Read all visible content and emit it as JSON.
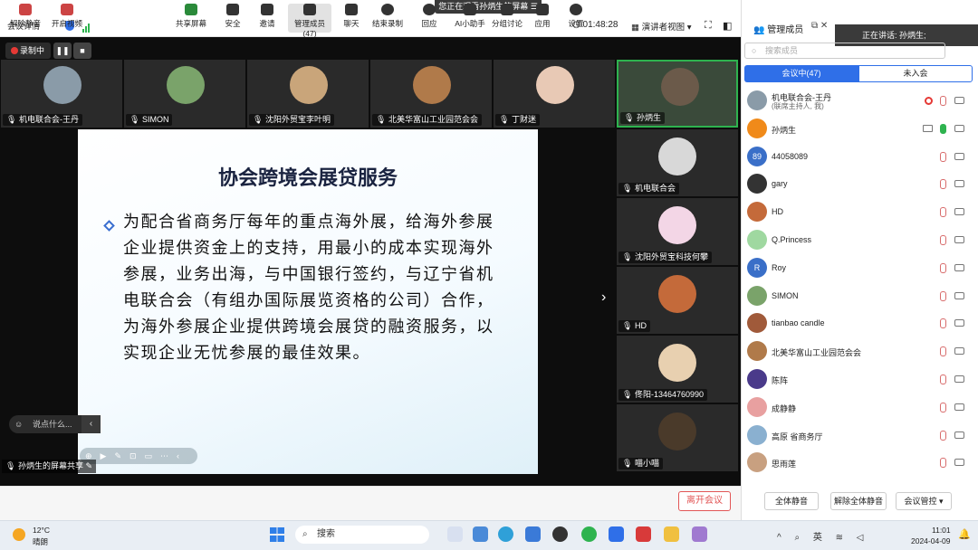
{
  "topbar": {
    "meeting_detail": "会议详情",
    "watching": "您正在观看孙炳生的屏幕",
    "watching_icon": "menu-lines-icon",
    "timer": "01:48:28",
    "view_mode": "演讲者视图"
  },
  "recording": {
    "label": "录制中",
    "pause": "❚❚",
    "stop": "■"
  },
  "tiles": [
    {
      "name": "机电联合会-王丹",
      "color": "#8a9ba8"
    },
    {
      "name": "SIMON",
      "color": "#7aa36a"
    },
    {
      "name": "沈阳外贸宝李叶明",
      "color": "#c9a57a"
    },
    {
      "name": "北美华富山工业园范会会",
      "color": "#b07a4a"
    },
    {
      "name": "丁财迷",
      "color": "#e8c9b5"
    },
    {
      "name": "孙炳生",
      "color": "#6b5a4a"
    }
  ],
  "right_tiles": [
    {
      "name": "机电联合会",
      "color": "#d8d8d8"
    },
    {
      "name": "沈阳外贸宝科技何攀",
      "color": "#f3d6e6"
    },
    {
      "name": "HD",
      "color": "#c46a3a"
    },
    {
      "name": "佟阳-13464760990",
      "color": "#e8d0b0"
    },
    {
      "name": "喵小喵",
      "color": "#4a3a2a"
    }
  ],
  "slide": {
    "title": "协会跨境会展贷服务",
    "body": "为配合省商务厅每年的重点海外展，给海外参展企业提供资金上的支持，用最小的成本实现海外参展，业务出海，与中国银行签约，与辽宁省机电联合会（有组办国际展览资格的公司）合作，为海外参展企业提供跨境会展贷的融资服务，以实现企业无忧参展的最佳效果。"
  },
  "chat": {
    "placeholder": "说点什么...",
    "collapse": "‹"
  },
  "share_label": "孙炳生的屏幕共享",
  "toolbar": {
    "mute": "解除静音",
    "video": "开启视频",
    "share": "共享屏幕",
    "security": "安全",
    "invite": "邀请",
    "members": "管理成员(47)",
    "chat": "聊天",
    "end_record": "结束录制",
    "reaction": "回应",
    "ai": "AI小助手",
    "breakout": "分组讨论",
    "apps": "应用",
    "settings": "设置",
    "leave": "离开会议"
  },
  "panel": {
    "title": "管理成员",
    "speaking": "正在讲话:  孙炳生;",
    "search_placeholder": "搜索成员",
    "tab_in": "会议中(47)",
    "tab_out": "未入会",
    "members": [
      {
        "name": "机电联合会-王丹",
        "sub": "(联席主持人, 我)",
        "color": "#8a9ba8",
        "initial": "",
        "mic": "muted",
        "rec": true,
        "share": false
      },
      {
        "name": "孙炳生",
        "sub": "",
        "color": "#f08a1a",
        "initial": "",
        "mic": "on",
        "rec": false,
        "share": true
      },
      {
        "name": "44058089",
        "sub": "",
        "color": "#3a6fc8",
        "initial": "89",
        "mic": "muted",
        "rec": false,
        "share": false
      },
      {
        "name": "gary",
        "sub": "",
        "color": "#333333",
        "initial": "",
        "mic": "muted",
        "rec": false,
        "share": false
      },
      {
        "name": "HD",
        "sub": "",
        "color": "#c46a3a",
        "initial": "",
        "mic": "muted",
        "rec": false,
        "share": false
      },
      {
        "name": "Q.Princess",
        "sub": "",
        "color": "#9fd8a0",
        "initial": "",
        "mic": "muted",
        "rec": false,
        "share": false
      },
      {
        "name": "Roy",
        "sub": "",
        "color": "#3a6fc8",
        "initial": "R",
        "mic": "muted",
        "rec": false,
        "share": false
      },
      {
        "name": "SIMON",
        "sub": "",
        "color": "#7aa36a",
        "initial": "",
        "mic": "muted",
        "rec": false,
        "share": false
      },
      {
        "name": "tianbao candle",
        "sub": "",
        "color": "#a05a3a",
        "initial": "",
        "mic": "muted",
        "rec": false,
        "share": false
      },
      {
        "name": "北美华富山工业园范会会",
        "sub": "",
        "color": "#b07a4a",
        "initial": "",
        "mic": "muted",
        "rec": false,
        "share": false
      },
      {
        "name": "陈阵",
        "sub": "",
        "color": "#4a3a8a",
        "initial": "",
        "mic": "muted",
        "rec": false,
        "share": false
      },
      {
        "name": "成静静",
        "sub": "",
        "color": "#e8a0a0",
        "initial": "",
        "mic": "muted",
        "rec": false,
        "share": false
      },
      {
        "name": "高原 省商务厅",
        "sub": "",
        "color": "#8ab0d0",
        "initial": "",
        "mic": "muted",
        "rec": false,
        "share": false
      },
      {
        "name": "思雨莲",
        "sub": "",
        "color": "#c8a080",
        "initial": "",
        "mic": "muted",
        "rec": false,
        "share": false
      }
    ],
    "mute_all": "全体静音",
    "unmute_all": "解除全体静音",
    "controls": "会议管控 ▾"
  },
  "taskbar": {
    "temp": "12°C",
    "weather": "晴朗",
    "search": "搜索",
    "tray": "^  ⌕  英  ≋  ◁",
    "time": "11:01",
    "date": "2024-04-09",
    "bell": "🔔"
  }
}
